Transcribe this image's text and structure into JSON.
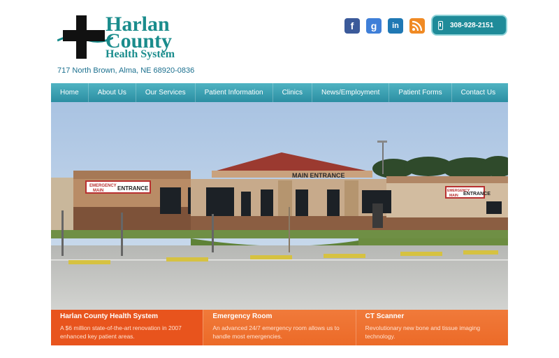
{
  "brand": {
    "line1": "Harlan",
    "line2": "County",
    "line3": "Health System",
    "address": "717 North Brown, Alma, NE 68920-0836",
    "color": "#1a8c8c"
  },
  "social": {
    "icons": [
      "facebook-icon",
      "google-icon",
      "linkedin-icon",
      "rss-icon"
    ],
    "fb_glyph": "f",
    "g_glyph": "g",
    "li_glyph": "in"
  },
  "phone": {
    "number": "308-928-2151"
  },
  "nav": {
    "items": [
      "Home",
      "About Us",
      "Our Services",
      "Patient Information",
      "Clinics",
      "News/Employment",
      "Patient Forms",
      "Contact Us"
    ]
  },
  "hero": {
    "sign_main": "MAIN ENTRANCE",
    "sign_left_top": "EMERGENCY",
    "sign_left_mid": "MAIN",
    "sign_left_right": "ENTRANCE",
    "sign_right_top": "EMERGENCY",
    "sign_right_mid": "MAIN",
    "sign_right_right": "ENTRANCE"
  },
  "features": [
    {
      "title": "Harlan County Health System",
      "text": "A $6 million state-of-the-art renovation in 2007 enhanced key patient areas."
    },
    {
      "title": "Emergency Room",
      "text": "An advanced 24/7 emergency room allows us to handle most emergencies."
    },
    {
      "title": "CT Scanner",
      "text": "Revolutionary new bone and tissue imaging technology."
    }
  ],
  "colors": {
    "accent": "#2b8ea2",
    "orange": "#ec6a28",
    "orange_active": "#e8541d"
  }
}
